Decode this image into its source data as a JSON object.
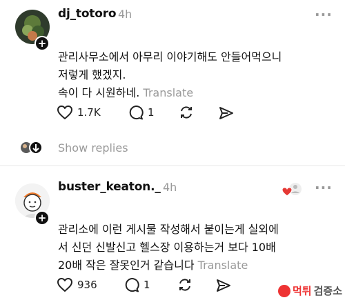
{
  "posts": [
    {
      "username": "dj_totoro",
      "time": "4h",
      "more_icon": "more-horizontal-icon",
      "text": "관리사무소에서 아무리 이야기해도 안들어먹으니\n저렇게 했겠지.\n속이 다 시원하네.",
      "translate_label": "Translate",
      "likes": "1.7K",
      "replies": "1"
    },
    {
      "username": "buster_keaton._",
      "time": "4h",
      "more_icon": "more-horizontal-icon",
      "text": "관리소에 이런 게시물 작성해서 붙이는게 실외에\n서 신던 신발신고 헬스장 이용하는거 보다 10배\n20배 작은 잘못인거 같습니다",
      "translate_label": "Translate",
      "likes": "936",
      "replies": "1"
    }
  ],
  "show_replies_label": "Show replies",
  "watermark": {
    "part1": "먹튀",
    "part2": "검증소"
  },
  "colors": {
    "text": "#111111",
    "muted": "#9a9a9a",
    "divider": "#e6e6e6",
    "heart_badge": "#e53935"
  }
}
